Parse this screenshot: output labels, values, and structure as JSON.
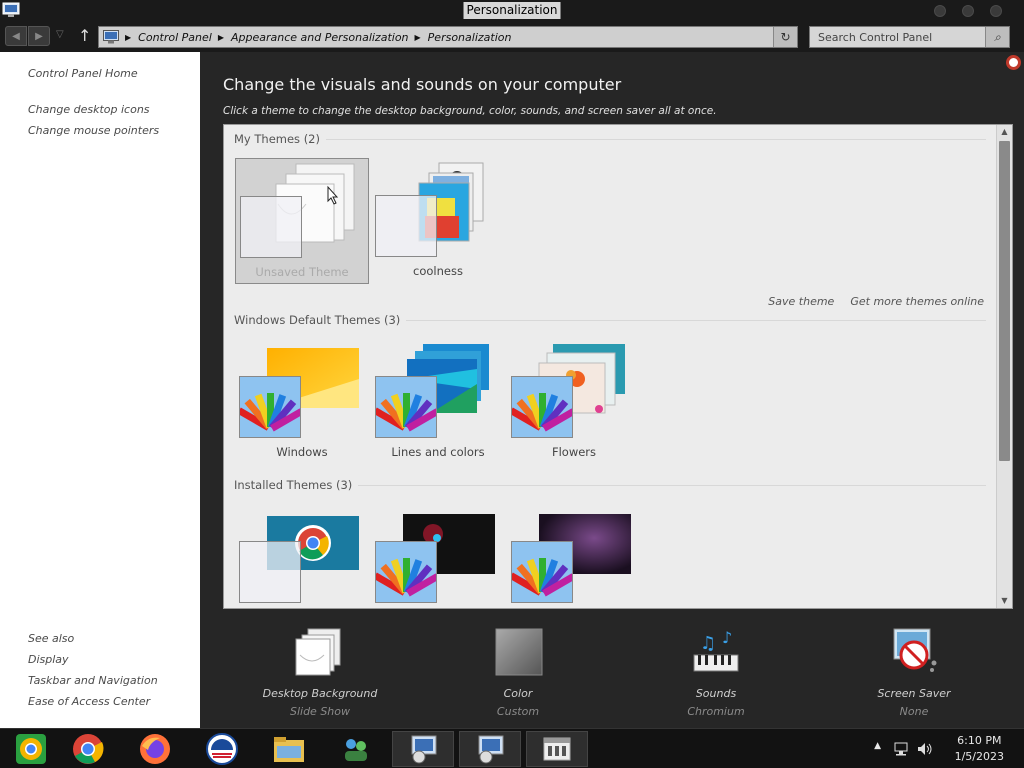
{
  "window": {
    "title": "Personalization"
  },
  "nav": {
    "breadcrumbs": [
      "Control Panel",
      "Appearance and Personalization",
      "Personalization"
    ],
    "search_placeholder": "Search Control Panel"
  },
  "left_pane": {
    "links": [
      "Control Panel Home",
      "Change desktop icons",
      "Change mouse pointers"
    ],
    "see_also_title": "See also",
    "see_also": [
      "Display",
      "Taskbar and Navigation",
      "Ease of Access Center"
    ]
  },
  "main": {
    "heading": "Change the visuals and sounds on your computer",
    "subheading": "Click a theme to change the desktop background, color, sounds, and screen saver all at once.",
    "groups": [
      {
        "title": "My Themes (2)",
        "themes": [
          "Unsaved Theme",
          "coolness"
        ]
      },
      {
        "title": "Windows Default Themes (3)",
        "themes": [
          "Windows",
          "Lines and colors",
          "Flowers"
        ]
      },
      {
        "title": "Installed Themes (3)",
        "themes": [
          "",
          "",
          ""
        ]
      }
    ],
    "links": {
      "save_theme": "Save theme",
      "get_more": "Get more themes online"
    }
  },
  "bottom": [
    {
      "label": "Desktop Background",
      "value": "Slide Show",
      "icon": "desktop-background-icon"
    },
    {
      "label": "Color",
      "value": "Custom",
      "icon": "color-icon"
    },
    {
      "label": "Sounds",
      "value": "Chromium",
      "icon": "sounds-icon"
    },
    {
      "label": "Screen Saver",
      "value": "None",
      "icon": "screen-saver-icon"
    }
  ],
  "taskbar": {
    "time": "6:10 PM",
    "date": "1/5/2023",
    "apps": [
      "chrome-canary-icon",
      "chrome-icon",
      "firefox-icon",
      "obama-icon",
      "file-explorer-icon",
      "network-people-icon",
      "control-panel-icon",
      "control-panel-icon-2",
      "personalization-window-icon"
    ]
  },
  "colors": {
    "accent_red": "#c0392b",
    "main_bg": "#262626",
    "themes_bg": "#ececec"
  }
}
